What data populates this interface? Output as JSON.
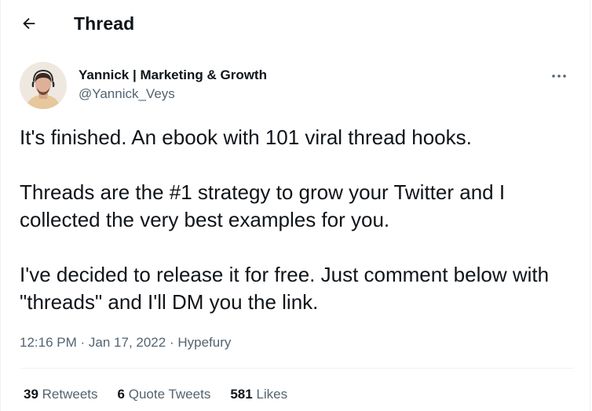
{
  "header": {
    "back_icon": "arrow-left-icon",
    "title": "Thread"
  },
  "author": {
    "display_name": "Yannick | Marketing & Growth",
    "handle": "@Yannick_Veys",
    "avatar": "avatar-photo"
  },
  "more_icon": "ellipsis-icon",
  "tweet": {
    "paragraphs": [
      "It's finished. An ebook with 101 viral thread hooks.",
      "Threads are the #1 strategy to grow your Twitter and I collected the very best examples for you.",
      "I've decided to release it for free. Just comment below with \"threads\" and I'll DM you the link."
    ],
    "time": "12:16 PM",
    "date": "Jan 17, 2022",
    "separator": "·",
    "source": "Hypefury"
  },
  "stats": [
    {
      "count": "39",
      "label": "Retweets"
    },
    {
      "count": "6",
      "label": "Quote Tweets"
    },
    {
      "count": "581",
      "label": "Likes"
    }
  ],
  "colors": {
    "text_primary": "#0f1419",
    "text_secondary": "#536471",
    "divider": "#eff3f4"
  }
}
